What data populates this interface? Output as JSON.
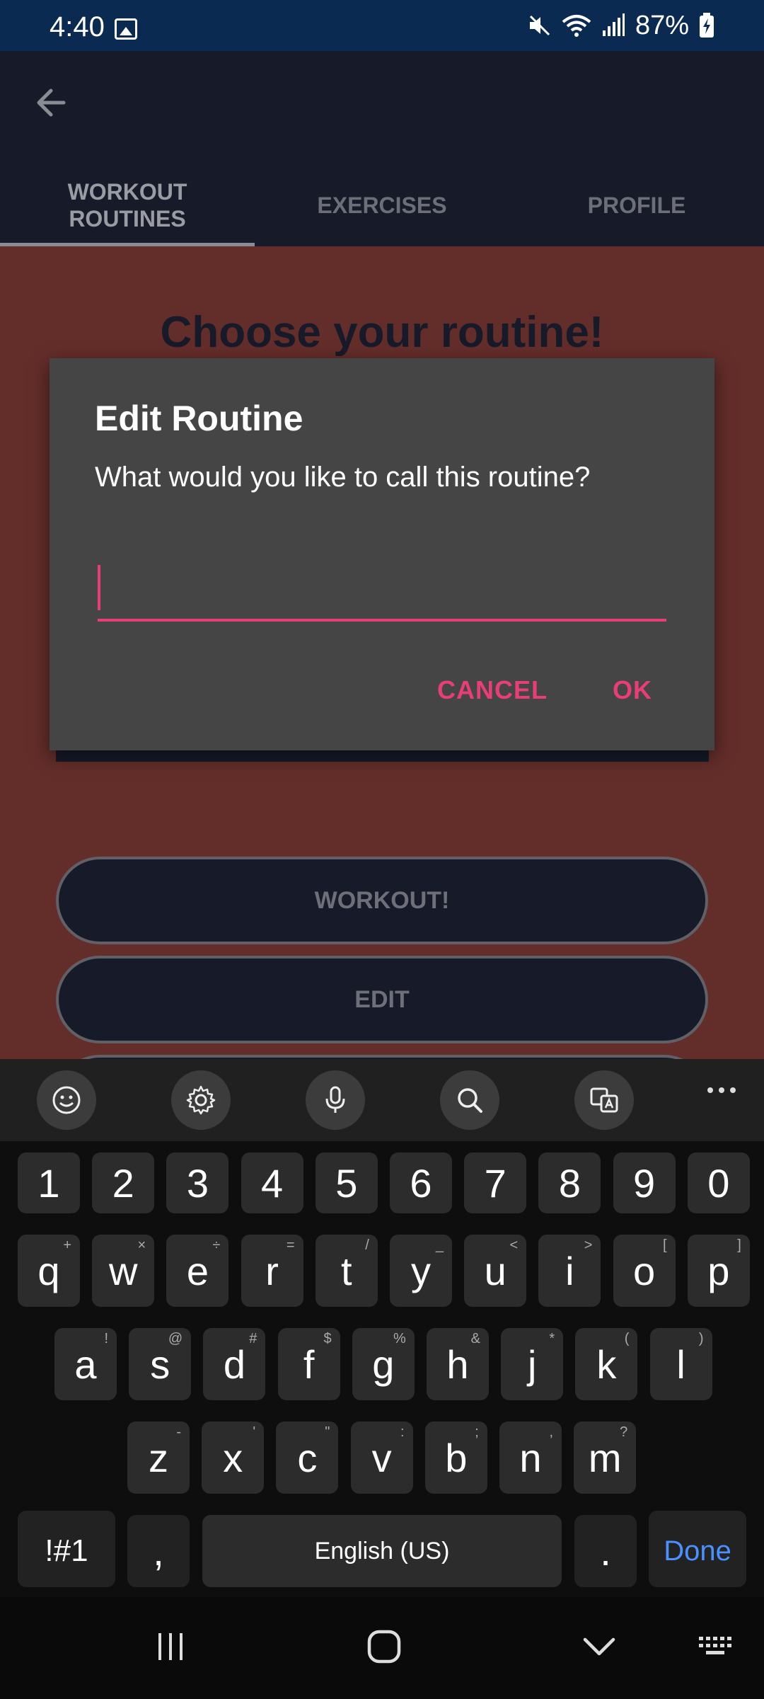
{
  "status_bar": {
    "time": "4:40",
    "battery": "87%"
  },
  "app_bar": {
    "tabs": [
      {
        "label": "WORKOUT\nROUTINES",
        "active": true
      },
      {
        "label": "EXERCISES",
        "active": false
      },
      {
        "label": "PROFILE",
        "active": false
      }
    ]
  },
  "main": {
    "title": "Choose your routine!",
    "buttons": {
      "workout": "WORKOUT!",
      "edit": "EDIT"
    }
  },
  "dialog": {
    "title": "Edit Routine",
    "message": "What would you like to call this routine?",
    "input_value": "",
    "cancel": "CANCEL",
    "ok": "OK"
  },
  "keyboard": {
    "number_row": [
      "1",
      "2",
      "3",
      "4",
      "5",
      "6",
      "7",
      "8",
      "9",
      "0"
    ],
    "row1": [
      {
        "k": "q",
        "h": "+"
      },
      {
        "k": "w",
        "h": "×"
      },
      {
        "k": "e",
        "h": "÷"
      },
      {
        "k": "r",
        "h": "="
      },
      {
        "k": "t",
        "h": "/"
      },
      {
        "k": "y",
        "h": "_"
      },
      {
        "k": "u",
        "h": "<"
      },
      {
        "k": "i",
        "h": ">"
      },
      {
        "k": "o",
        "h": "["
      },
      {
        "k": "p",
        "h": "]"
      }
    ],
    "row2": [
      {
        "k": "a",
        "h": "!"
      },
      {
        "k": "s",
        "h": "@"
      },
      {
        "k": "d",
        "h": "#"
      },
      {
        "k": "f",
        "h": "$"
      },
      {
        "k": "g",
        "h": "%"
      },
      {
        "k": "h",
        "h": "&"
      },
      {
        "k": "j",
        "h": "*"
      },
      {
        "k": "k",
        "h": "("
      },
      {
        "k": "l",
        "h": ")"
      }
    ],
    "row3": [
      {
        "k": "z",
        "h": "-"
      },
      {
        "k": "x",
        "h": "'"
      },
      {
        "k": "c",
        "h": "\""
      },
      {
        "k": "v",
        "h": ":"
      },
      {
        "k": "b",
        "h": ";"
      },
      {
        "k": "n",
        "h": ","
      },
      {
        "k": "m",
        "h": "?"
      }
    ],
    "symbols_key": "!#1",
    "comma_key": ",",
    "space_label": "English (US)",
    "period_key": ".",
    "done_key": "Done"
  },
  "colors": {
    "status_bar": "#0b2a52",
    "app_bar": "#171a29",
    "main_bg": "#632d2a",
    "dialog_bg": "#454545",
    "accent": "#e83e76",
    "done_blue": "#4a90ff"
  }
}
